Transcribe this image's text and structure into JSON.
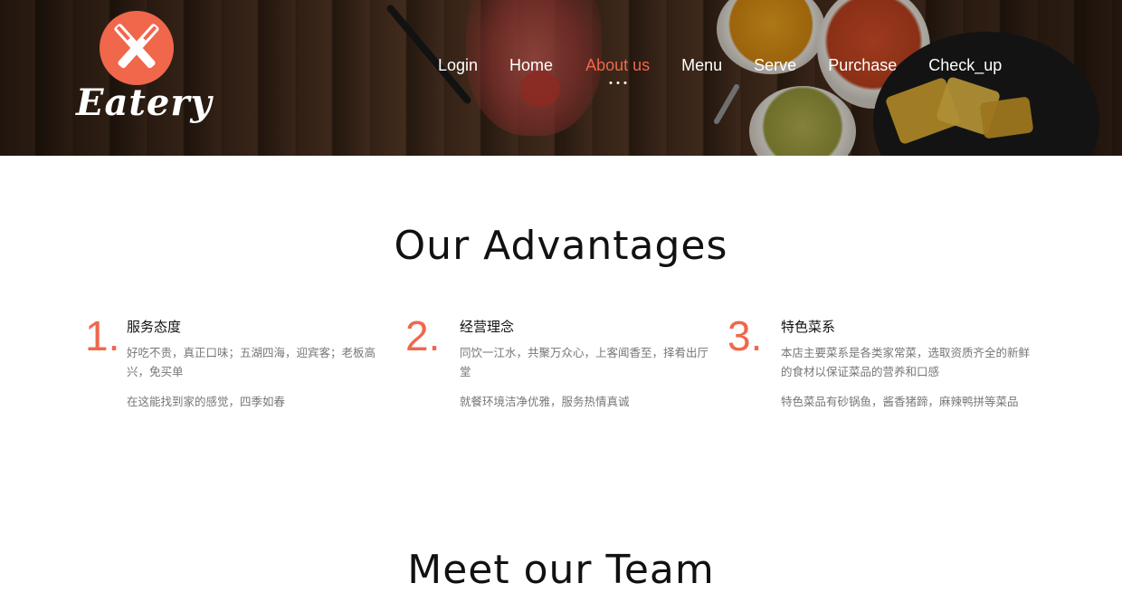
{
  "brand": {
    "name": "Eatery",
    "accent_color": "#f0674c"
  },
  "nav": {
    "items": [
      {
        "label": "Login",
        "active": false
      },
      {
        "label": "Home",
        "active": false
      },
      {
        "label": "About us",
        "active": true
      },
      {
        "label": "Menu",
        "active": false
      },
      {
        "label": "Serve",
        "active": false
      },
      {
        "label": "Purchase",
        "active": false
      },
      {
        "label": "Check_up",
        "active": false
      }
    ]
  },
  "advantages": {
    "title": "Our Advantages",
    "items": [
      {
        "number": "1.",
        "heading": "服务态度",
        "text": "好吃不贵，真正口味；五湖四海，迎宾客；老板高兴，免买单",
        "text2": "在这能找到家的感觉，四季如春"
      },
      {
        "number": "2.",
        "heading": "经营理念",
        "text": "同饮一江水，共聚万众心，上客闻香至，择肴出厅堂",
        "text2": "就餐环境洁净优雅，服务热情真诚"
      },
      {
        "number": "3.",
        "heading": "特色菜系",
        "text": "本店主要菜系是各类家常菜，选取资质齐全的新鲜的食材以保证菜品的营养和口感",
        "text2": "特色菜品有砂锅鱼，酱香猪蹄，麻辣鸭拼等菜品"
      }
    ]
  },
  "team": {
    "title": "Meet our Team"
  }
}
